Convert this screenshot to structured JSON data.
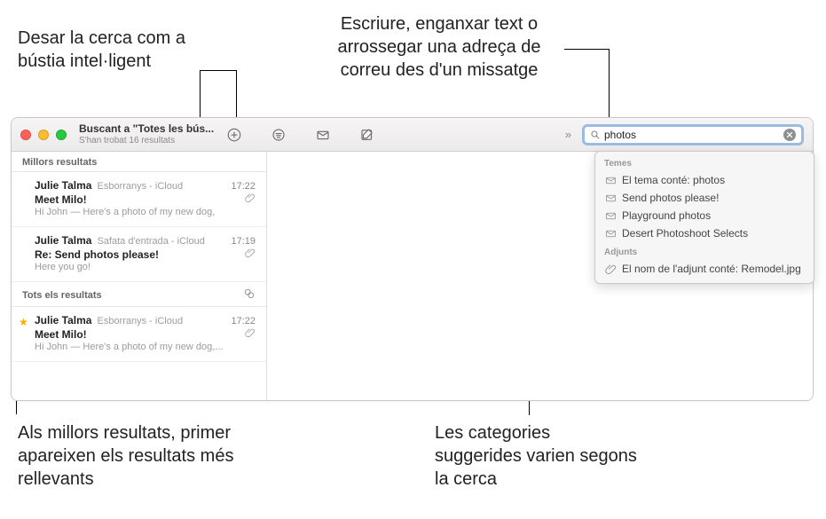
{
  "callouts": {
    "save_smart": "Desar la cerca com a bústia intel·ligent",
    "type_paste": "Escriure, enganxar text o arrossegar una adreça de correu des d'un missatge",
    "best_first": "Als millors resultats, primer apareixen els resultats més rellevants",
    "categories": "Les categories suggerides varien segons la cerca"
  },
  "toolbar": {
    "title": "Buscant a \"Totes les bús...",
    "subtitle": "S'han trobat 16 resultats",
    "chevrons": "»"
  },
  "search": {
    "value": "photos",
    "placeholder": ""
  },
  "sections": {
    "best": "Millors resultats",
    "all": "Tots els resultats"
  },
  "messages": {
    "best": [
      {
        "sender": "Julie Talma",
        "folder": "Esborranys - iCloud",
        "time": "17:22",
        "subject": "Meet Milo!",
        "preview": "Hi John — Here's a photo of my new dog,",
        "attachment": true,
        "starred": false
      },
      {
        "sender": "Julie Talma",
        "folder": "Safata d'entrada - iCloud",
        "time": "17:19",
        "subject": "Re: Send photos please!",
        "preview": "Here you go!",
        "attachment": true,
        "starred": false
      }
    ],
    "all": [
      {
        "sender": "Julie Talma",
        "folder": "Esborranys - iCloud",
        "time": "17:22",
        "subject": "Meet Milo!",
        "preview": "Hi John — Here's a photo of my new dog,...",
        "attachment": true,
        "starred": true
      }
    ]
  },
  "suggestions": {
    "topics_header": "Temes",
    "topics": [
      "El tema conté: photos",
      "Send photos please!",
      "Playground photos",
      "Desert Photoshoot Selects"
    ],
    "attachments_header": "Adjunts",
    "attachments": [
      "El nom de l'adjunt conté: Remodel.jpg"
    ]
  }
}
